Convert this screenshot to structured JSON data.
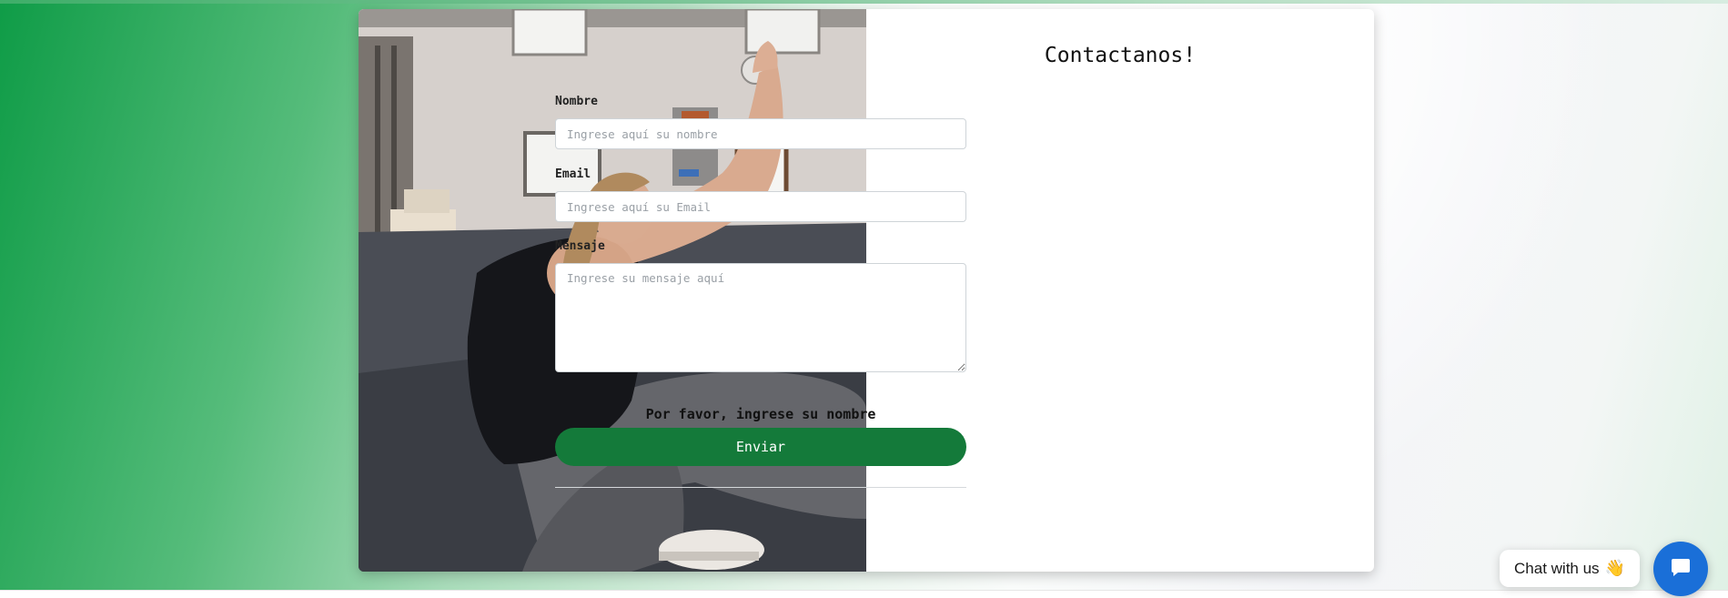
{
  "form": {
    "title": "Contactanos!",
    "fields": {
      "nombre": {
        "label": "Nombre",
        "placeholder": "Ingrese aquí su nombre"
      },
      "email": {
        "label": "Email",
        "placeholder": "Ingrese aquí su Email"
      },
      "mensaje": {
        "label": "Mensaje",
        "placeholder": "Ingrese su mensaje aquí"
      }
    },
    "validation_message": "Por favor, ingrese su nombre",
    "submit_label": "Enviar"
  },
  "chat_widget": {
    "bubble_text": "Chat with us",
    "bubble_emoji": "👋",
    "launcher_icon": "chat-icon",
    "launcher_color": "#1a6fd8"
  },
  "colors": {
    "accent": "#147a3a",
    "background_green": "#0f9c47"
  }
}
